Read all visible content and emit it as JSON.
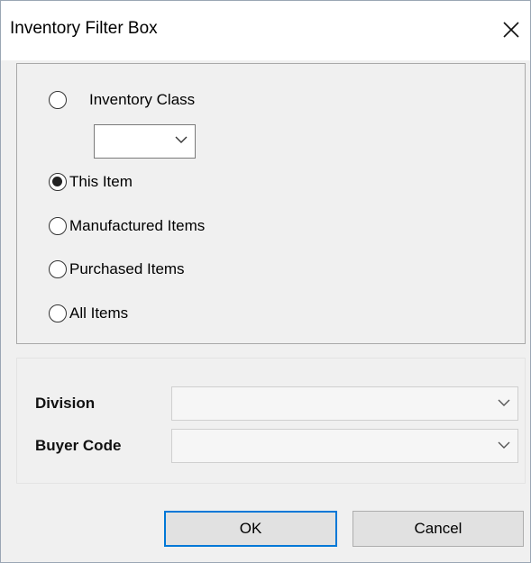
{
  "window": {
    "title": "Inventory Filter Box"
  },
  "filter": {
    "options": {
      "inventory_class": "Inventory Class",
      "this_item": "This Item",
      "manufactured": "Manufactured Items",
      "purchased": "Purchased Items",
      "all": "All Items"
    },
    "selected": "This Item",
    "inventory_class_value": ""
  },
  "fields": {
    "division": {
      "label": "Division",
      "value": ""
    },
    "buyer_code": {
      "label": "Buyer Code",
      "value": ""
    }
  },
  "buttons": {
    "ok": "OK",
    "cancel": "Cancel"
  },
  "icons": {
    "close": "close-icon",
    "dropdown": "chevron-down-icon"
  },
  "colors": {
    "accent": "#0078d7"
  }
}
